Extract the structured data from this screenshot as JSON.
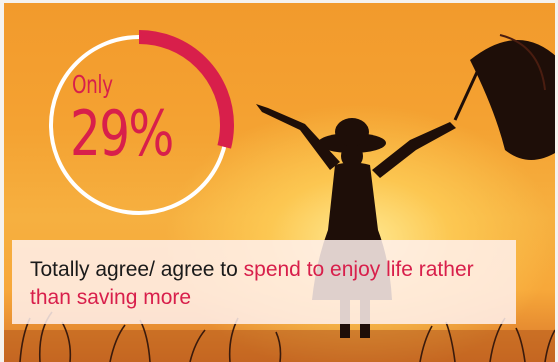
{
  "stat": {
    "prefix": "Only",
    "value": "29%",
    "percent": 29
  },
  "caption": {
    "plain": "Totally agree/ agree to ",
    "highlight": "spend to enjoy life rather than saving more"
  },
  "colors": {
    "accent": "#d81f4b",
    "ring_track": "#ffffff",
    "text": "#1a1a1a"
  }
}
